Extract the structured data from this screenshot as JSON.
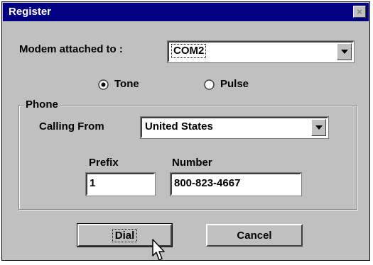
{
  "window": {
    "title": "Register",
    "close_glyph": "×"
  },
  "modem": {
    "label": "Modem attached to :",
    "selected": "COM2"
  },
  "dial_mode": {
    "options": [
      {
        "label": "Tone",
        "selected": true
      },
      {
        "label": "Pulse",
        "selected": false
      }
    ]
  },
  "phone": {
    "group_title": "Phone",
    "calling_from_label": "Calling From",
    "calling_from_value": "United States",
    "prefix_label": "Prefix",
    "prefix_value": "1",
    "number_label": "Number",
    "number_value": "800-823-4667"
  },
  "buttons": {
    "dial": "Dial",
    "cancel": "Cancel"
  },
  "icons": {
    "dropdown": "chevron-down-icon",
    "cursor": "mouse-pointer-icon"
  },
  "colors": {
    "titlebar": "#000080",
    "face": "#c0c0c0"
  }
}
